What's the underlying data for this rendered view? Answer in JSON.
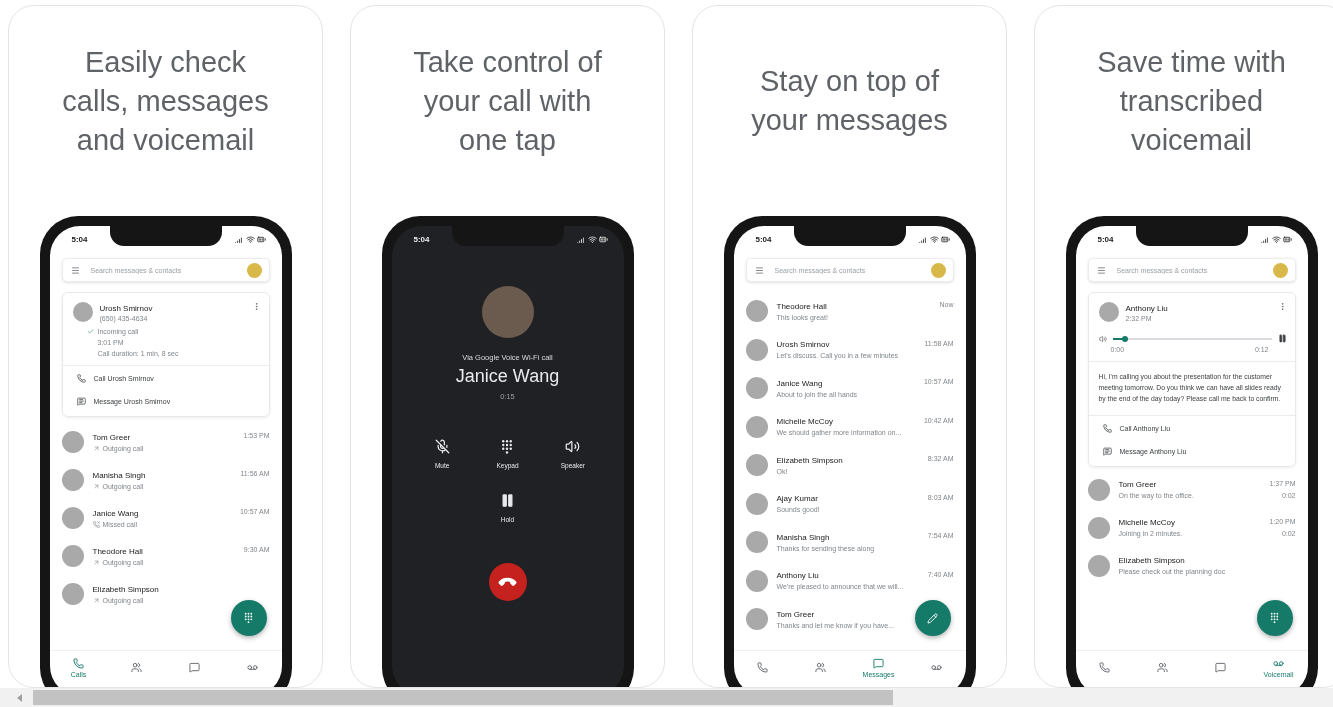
{
  "cards": [
    {
      "kind": "calls",
      "caption": [
        "Easily check",
        "calls, messages",
        "and voicemail"
      ],
      "phone": {
        "time": "5:04",
        "search_placeholder": "Search messages & contacts",
        "detail": {
          "name": "Urosh Smirnov",
          "number": "(650) 435-4634",
          "call_type": "Incoming call",
          "call_time": "3:01 PM",
          "duration": "Call duration: 1 min, 8 sec",
          "actions": [
            {
              "kind": "call",
              "label": "Call Urosh Smirnov"
            },
            {
              "kind": "message",
              "label": "Message Urosh Smirnov"
            }
          ]
        },
        "rows": [
          {
            "name": "Tom Greer",
            "detail": "Outgoing call",
            "kind": "outgoing",
            "time": "1:53 PM"
          },
          {
            "name": "Manisha Singh",
            "detail": "Outgoing call",
            "kind": "outgoing",
            "time": "11:56 AM"
          },
          {
            "name": "Janice Wang",
            "detail": "Missed call",
            "kind": "missed",
            "time": "10:57 AM"
          },
          {
            "name": "Theodore Hall",
            "detail": "Outgoing call",
            "kind": "outgoing",
            "time": "9:30 AM"
          },
          {
            "name": "Elizabeth Simpson",
            "detail": "Outgoing call",
            "kind": "outgoing"
          }
        ],
        "fab": {
          "kind": "dialpad"
        },
        "nav": [
          {
            "kind": "calls",
            "label": "Calls",
            "selected": true
          },
          {
            "kind": "contacts",
            "selected": false
          },
          {
            "kind": "messages",
            "selected": false
          },
          {
            "kind": "voicemail",
            "selected": false
          }
        ]
      }
    },
    {
      "kind": "call",
      "caption": [
        "Take control of",
        "your call with",
        "one tap"
      ],
      "phone": {
        "time": "5:04",
        "via": "Via Google Voice Wi-Fi call",
        "name": "Janice Wang",
        "elapsed": "0:15",
        "controls": [
          {
            "kind": "mute",
            "label": "Mute"
          },
          {
            "kind": "keypad",
            "label": "Keypad"
          },
          {
            "kind": "speaker",
            "label": "Speaker"
          },
          {
            "kind": "hold",
            "label": "Hold"
          }
        ]
      }
    },
    {
      "kind": "messages",
      "caption": [
        "Stay on top of",
        "your messages"
      ],
      "phone": {
        "time": "5:04",
        "search_placeholder": "Search messages & contacts",
        "rows": [
          {
            "name": "Theodore Hall",
            "preview": "This looks great!",
            "time": "Now"
          },
          {
            "name": "Urosh Smirnov",
            "preview": "Let's discuss. Call you in a few minutes",
            "time": "11:58 AM"
          },
          {
            "name": "Janice Wang",
            "preview": "About to join the all hands",
            "time": "10:57 AM"
          },
          {
            "name": "Michelle McCoy",
            "preview": "We should gather more information on...",
            "time": "10:42 AM"
          },
          {
            "name": "Elizabeth Simpson",
            "preview": "Ok!",
            "time": "8:32 AM"
          },
          {
            "name": "Ajay Kumar",
            "preview": "Sounds good!",
            "time": "8:03 AM"
          },
          {
            "name": "Manisha Singh",
            "preview": "Thanks for sending these along",
            "time": "7:54 AM"
          },
          {
            "name": "Anthony Liu",
            "preview": "We're pleased to announce that we will...",
            "time": "7:40 AM"
          },
          {
            "name": "Tom Greer",
            "preview": "Thanks and let me know if you have..."
          }
        ],
        "fab": {
          "kind": "compose"
        },
        "nav": [
          {
            "kind": "calls",
            "selected": false
          },
          {
            "kind": "contacts",
            "selected": false
          },
          {
            "kind": "messages",
            "label": "Messages",
            "selected": true
          },
          {
            "kind": "voicemail",
            "selected": false
          }
        ]
      }
    },
    {
      "kind": "voicemail",
      "caption": [
        "Save time with",
        "transcribed",
        "voicemail"
      ],
      "phone": {
        "time": "5:04",
        "search_placeholder": "Search messages & contacts",
        "detail": {
          "name": "Anthony Liu",
          "call_time": "2:32 PM",
          "player": {
            "level": 0.08,
            "start": "0:00",
            "end": "0:12"
          },
          "transcript": "Hi, I'm calling you about the presentation for the customer meeting tomorrow. Do you think we can have all slides ready by the end of the day today? Please call me back to confirm.",
          "actions": [
            {
              "kind": "call",
              "label": "Call Anthony Liu"
            },
            {
              "kind": "message",
              "label": "Message Anthony Liu"
            }
          ]
        },
        "rows": [
          {
            "name": "Tom Greer",
            "preview": "On the way to the office.",
            "time": "1:37 PM",
            "duration": "0:02"
          },
          {
            "name": "Michelle McCoy",
            "preview": "Joining in 2 minutes.",
            "time": "1:20 PM",
            "duration": "0:02"
          },
          {
            "name": "Elizabeth Simpson",
            "preview": "Please check out the planning doc"
          }
        ],
        "fab": {
          "kind": "dialpad"
        },
        "nav": [
          {
            "kind": "calls",
            "selected": false
          },
          {
            "kind": "contacts",
            "selected": false
          },
          {
            "kind": "messages",
            "selected": false
          },
          {
            "kind": "voicemail",
            "label": "Voicemail",
            "selected": true
          }
        ]
      }
    }
  ]
}
